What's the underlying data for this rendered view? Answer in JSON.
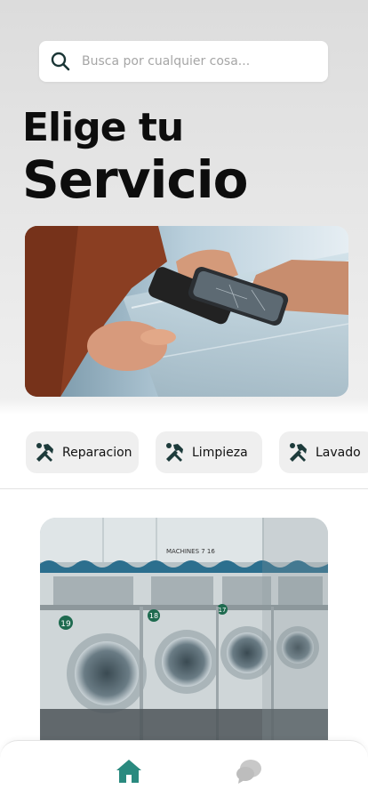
{
  "search": {
    "placeholder": "Busca por cualquier cosa...",
    "icon": "search-icon"
  },
  "headline": {
    "line1": "Elige tu",
    "line2": "Servicio"
  },
  "categories": [
    {
      "label": "Reparacion",
      "icon": "tools-icon"
    },
    {
      "label": "Limpieza",
      "icon": "tools-icon"
    },
    {
      "label": "Lavado",
      "icon": "tools-icon"
    }
  ],
  "hero_image": {
    "subject": "phone-repair-photo"
  },
  "card_image": {
    "subject": "laundromat-washers-photo",
    "sign_text": "MACHINES 7 16",
    "machine_numbers": [
      "19",
      "18",
      "17"
    ]
  },
  "nav": {
    "items": [
      {
        "icon": "home-icon",
        "active": true
      },
      {
        "icon": "chat-icon",
        "active": false
      }
    ]
  },
  "colors": {
    "accent": "#2a8a7f",
    "inactive": "#c8c8c8",
    "text": "#0d0d0d",
    "chip_bg": "#efefef"
  }
}
